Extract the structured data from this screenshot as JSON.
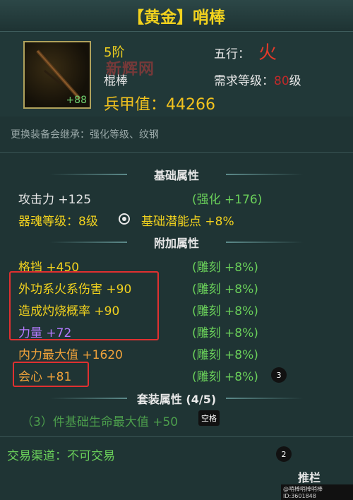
{
  "title": "【黄金】哨棒",
  "item": {
    "enhance": "+88",
    "tier": "5阶",
    "type": "棍棒",
    "element_label": "五行：",
    "element_value": "火",
    "level_label": "需求等级：",
    "level_value": "80",
    "level_suffix": "级",
    "armor": "兵甲值：44266",
    "watermark": "新辉网"
  },
  "inherit_note": "更换装备会继承：强化等级、纹钢",
  "basic": {
    "header": "基础属性",
    "attack_label": "攻击力  +125",
    "attack_bonus": "(强化 +176)",
    "soul_label": "器魂等级：8级",
    "potential_label": "基础潜能点   +8%"
  },
  "extra": {
    "header": "附加属性",
    "rows": [
      {
        "label": "格挡  +450",
        "engrave": "(雕刻 +8%)"
      },
      {
        "label": "外功系火系伤害   +90",
        "engrave": "(雕刻 +8%)"
      },
      {
        "label": "造成灼烧概率   +90",
        "engrave": "(雕刻 +8%)"
      },
      {
        "label": "力量  +72",
        "engrave": "(雕刻 +8%)"
      },
      {
        "label": "内力最大值   +1620",
        "engrave": "(雕刻 +8%)"
      },
      {
        "label": "会心  +81",
        "engrave": "(雕刻 +8%)"
      }
    ]
  },
  "set": {
    "header": "套装属性 (4/5)",
    "bonus": "（3）件基础生命最大值   +50",
    "chip": "空格"
  },
  "badges": {
    "b3": "3",
    "b2": "2"
  },
  "trade": "交易渠道：不可交易",
  "footer": {
    "logo": "推栏",
    "id": "@哨棒哨棒哨棒 ID:3601848"
  }
}
